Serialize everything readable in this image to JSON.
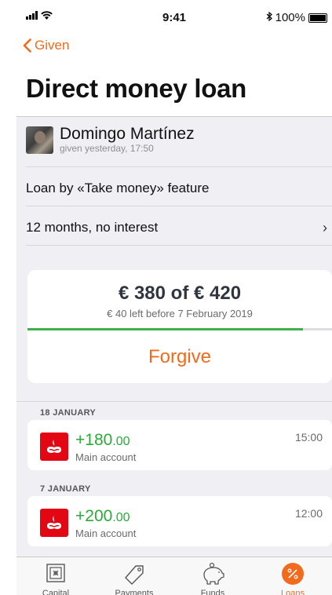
{
  "status_bar": {
    "time": "9:41",
    "battery": "100%"
  },
  "nav": {
    "back_label": "Given",
    "title": "Direct money loan"
  },
  "contact": {
    "name": "Domingo Martínez",
    "subtitle": "given yesterday, 17:50"
  },
  "details": {
    "feature": "Loan by «Take money» feature",
    "terms": "12 months, no interest",
    "terms_chevron": "›"
  },
  "loan": {
    "amount": "€ 380 of € 420",
    "remaining": "€ 40 left before 7 February 2019",
    "progress_fraction": 0.905,
    "forgive_label": "Forgive"
  },
  "transactions": [
    {
      "date": "18 JANUARY",
      "amount_int": "+180",
      "amount_dec": ".00",
      "account": "Main account",
      "time": "15:00"
    },
    {
      "date": "7 JANUARY",
      "amount_int": "+200",
      "amount_dec": ".00",
      "account": "Main account",
      "time": "12:00"
    }
  ],
  "tabs": [
    {
      "label": "Capital",
      "icon": "safe-icon"
    },
    {
      "label": "Payments",
      "icon": "tag-icon"
    },
    {
      "label": "Funds",
      "icon": "piggy-bank-icon"
    },
    {
      "label": "Loans",
      "icon": "percent-icon",
      "active": true
    }
  ],
  "colors": {
    "accent": "#f26a1b",
    "positive": "#2aab37",
    "progress": "#3cb34a",
    "bank": "#e30613"
  }
}
